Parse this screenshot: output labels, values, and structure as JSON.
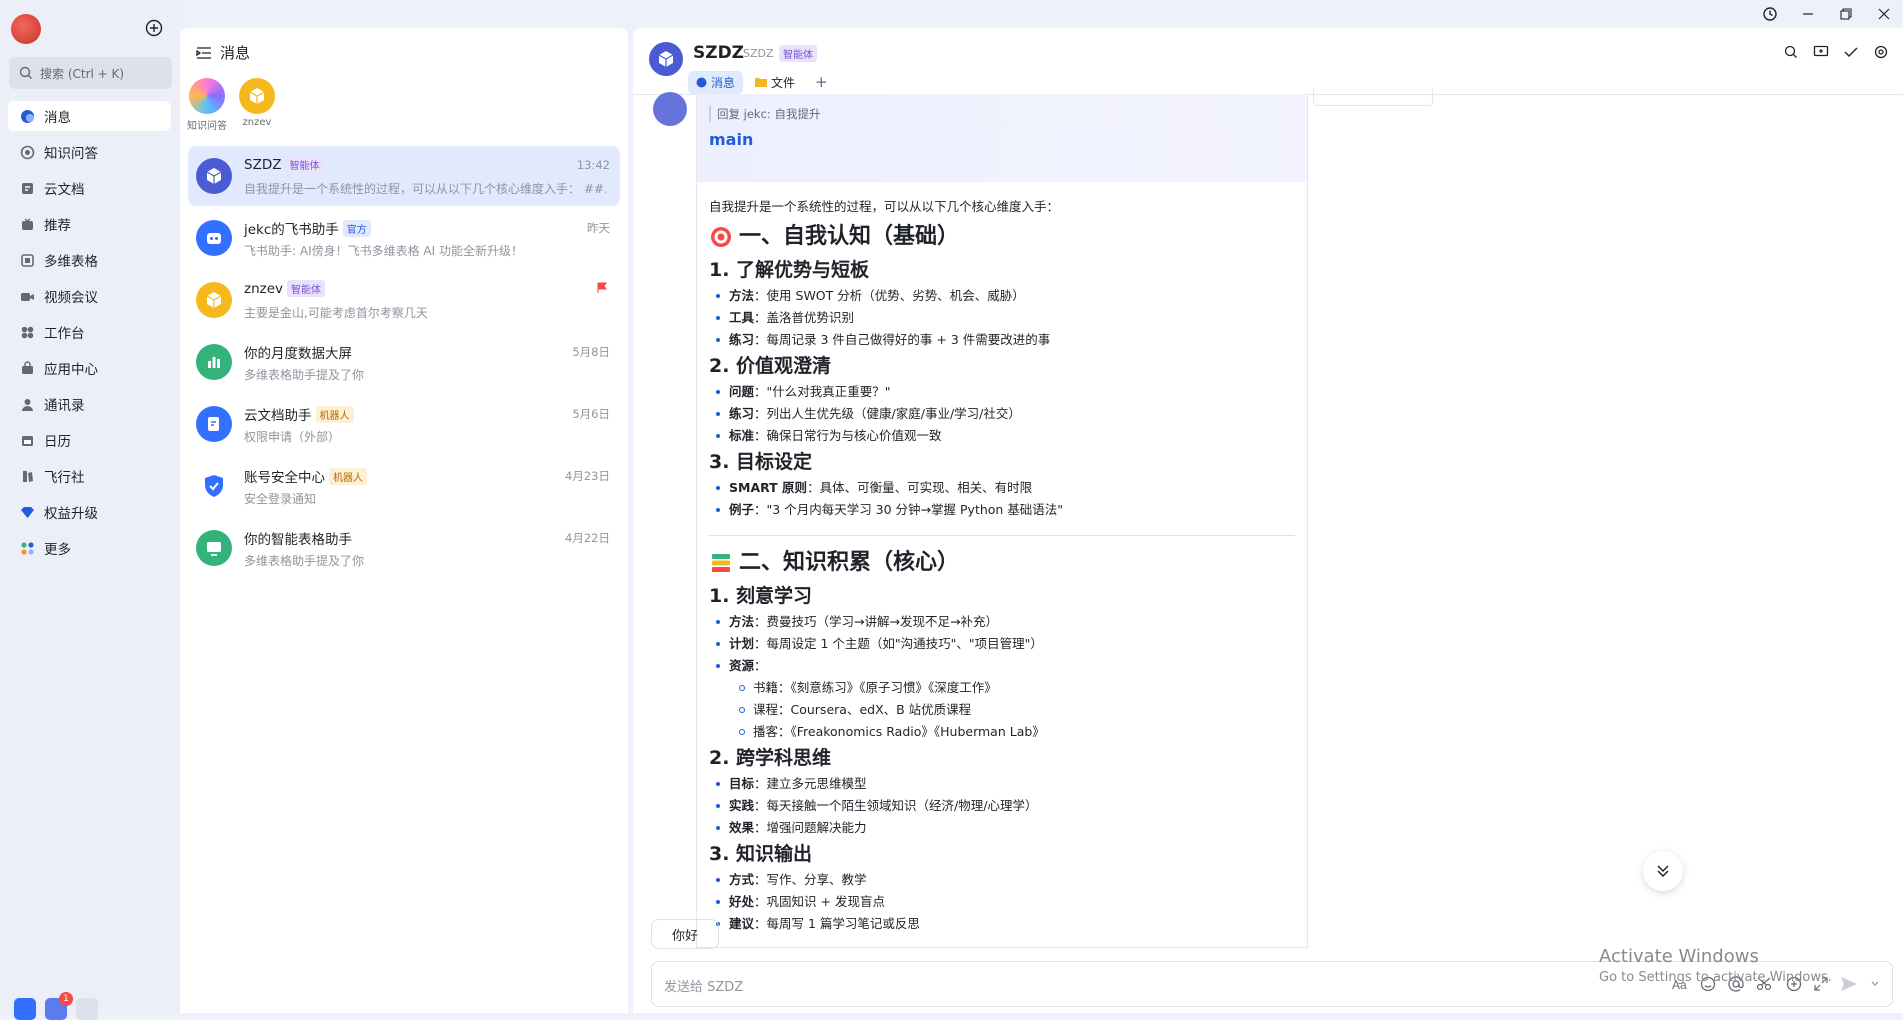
{
  "nav": {
    "search_placeholder": "搜索 (Ctrl + K)",
    "items": [
      {
        "label": "消息",
        "icon": "chat-bubble-icon"
      },
      {
        "label": "知识问答",
        "icon": "knowledge-icon"
      },
      {
        "label": "云文档",
        "icon": "cloud-doc-icon"
      },
      {
        "label": "推荐",
        "icon": "recommend-icon"
      },
      {
        "label": "多维表格",
        "icon": "base-table-icon"
      },
      {
        "label": "视频会议",
        "icon": "video-icon"
      },
      {
        "label": "工作台",
        "icon": "workspace-icon"
      },
      {
        "label": "应用中心",
        "icon": "app-center-icon"
      },
      {
        "label": "通讯录",
        "icon": "contacts-icon"
      },
      {
        "label": "日历",
        "icon": "calendar-icon"
      },
      {
        "label": "飞行社",
        "icon": "community-icon"
      },
      {
        "label": "权益升级",
        "icon": "diamond-icon"
      },
      {
        "label": "更多",
        "icon": "more-apps-icon"
      }
    ],
    "badge_count": "1"
  },
  "chatlist": {
    "title": "消息",
    "favorites": [
      {
        "label": "知识问答"
      },
      {
        "label": "znzev"
      }
    ],
    "rows": [
      {
        "name": "SZDZ",
        "tag": "智能体",
        "msg": "自我提升是一个系统性的过程，可以从以下几个核心维度入手： ##…",
        "time": "13:42"
      },
      {
        "name": "jekc的飞书助手",
        "tag": "官方",
        "msg": "飞书助手: AI傍身！飞书多维表格 AI 功能全新升级！",
        "time": "昨天"
      },
      {
        "name": "znzev",
        "tag": "智能体",
        "msg": "主要是金山,可能考虑首尔考察几天",
        "time": ""
      },
      {
        "name": "你的月度数据大屏",
        "tag": "",
        "msg": "多维表格助手提及了你",
        "time": "5月8日"
      },
      {
        "name": "云文档助手",
        "tag": "机器人",
        "msg": "权限申请（外部）",
        "time": "5月6日"
      },
      {
        "name": "账号安全中心",
        "tag": "机器人",
        "msg": "安全登录通知",
        "time": "4月23日"
      },
      {
        "name": "你的智能表格助手",
        "tag": "",
        "msg": "多维表格助手提及了你",
        "time": "4月22日"
      }
    ]
  },
  "conv": {
    "title": "SZDZ",
    "subtitle": "SZDZ",
    "tag": "智能体",
    "tabs": [
      "消息",
      "文件",
      "+"
    ],
    "reply_prefix": "回复 jekc:",
    "reply_text": "自我提升",
    "card_title": "main",
    "intro": "自我提升是一个系统性的过程，可以从以下几个核心维度入手：",
    "sec1": "一、自我认知（基础）",
    "s1a": "1. 了解优势与短板",
    "s1a_items": [
      {
        "k": "方法",
        "v": "使用 SWOT 分析（优势、劣势、机会、威胁）"
      },
      {
        "k": "工具",
        "v": "盖洛普优势识别"
      },
      {
        "k": "练习",
        "v": "每周记录 3 件自己做得好的事 + 3 件需要改进的事"
      }
    ],
    "s1b": "2. 价值观澄清",
    "s1b_items": [
      {
        "k": "问题",
        "v": "\"什么对我真正重要？\""
      },
      {
        "k": "练习",
        "v": "列出人生优先级（健康/家庭/事业/学习/社交）"
      },
      {
        "k": "标准",
        "v": "确保日常行为与核心价值观一致"
      }
    ],
    "s1c": "3. 目标设定",
    "s1c_items": [
      {
        "k": "SMART 原则",
        "v": "具体、可衡量、可实现、相关、有时限"
      },
      {
        "k": "例子",
        "v": "\"3 个月内每天学习 30 分钟→掌握 Python 基础语法\""
      }
    ],
    "sec2": "二、知识积累（核心）",
    "s2a": "1. 刻意学习",
    "s2a_items": [
      {
        "k": "方法",
        "v": "费曼技巧（学习→讲解→发现不足→补充）"
      },
      {
        "k": "计划",
        "v": "每周设定 1 个主题（如\"沟通技巧\"、\"项目管理\"）"
      },
      {
        "k": "资源",
        "v": ""
      }
    ],
    "s2a_sub": [
      "书籍：《刻意练习》《原子习惯》《深度工作》",
      "课程：Coursera、edX、B 站优质课程",
      "播客：《Freakonomics Radio》《Huberman Lab》"
    ],
    "s2b": "2. 跨学科思维",
    "s2b_items": [
      {
        "k": "目标",
        "v": "建立多元思维模型"
      },
      {
        "k": "实践",
        "v": "每天接触一个陌生领域知识（经济/物理/心理学）"
      },
      {
        "k": "效果",
        "v": "增强问题解决能力"
      }
    ],
    "s2c": "3. 知识输出",
    "s2c_items": [
      {
        "k": "方式",
        "v": "写作、分享、教学"
      },
      {
        "k": "好处",
        "v": "巩固知识 + 发现盲点"
      },
      {
        "k": "建议",
        "v": "每周写 1 篇学习笔记或反思"
      }
    ],
    "quick_reply": "你好",
    "input_placeholder": "发送给 SZDZ"
  },
  "watermark": {
    "line1": "Activate Windows",
    "line2": "Go to Settings to activate Windows."
  },
  "colors": {
    "accent": "#245bdb",
    "agent": "#4a5bd4",
    "bg": "#eef1fa"
  }
}
